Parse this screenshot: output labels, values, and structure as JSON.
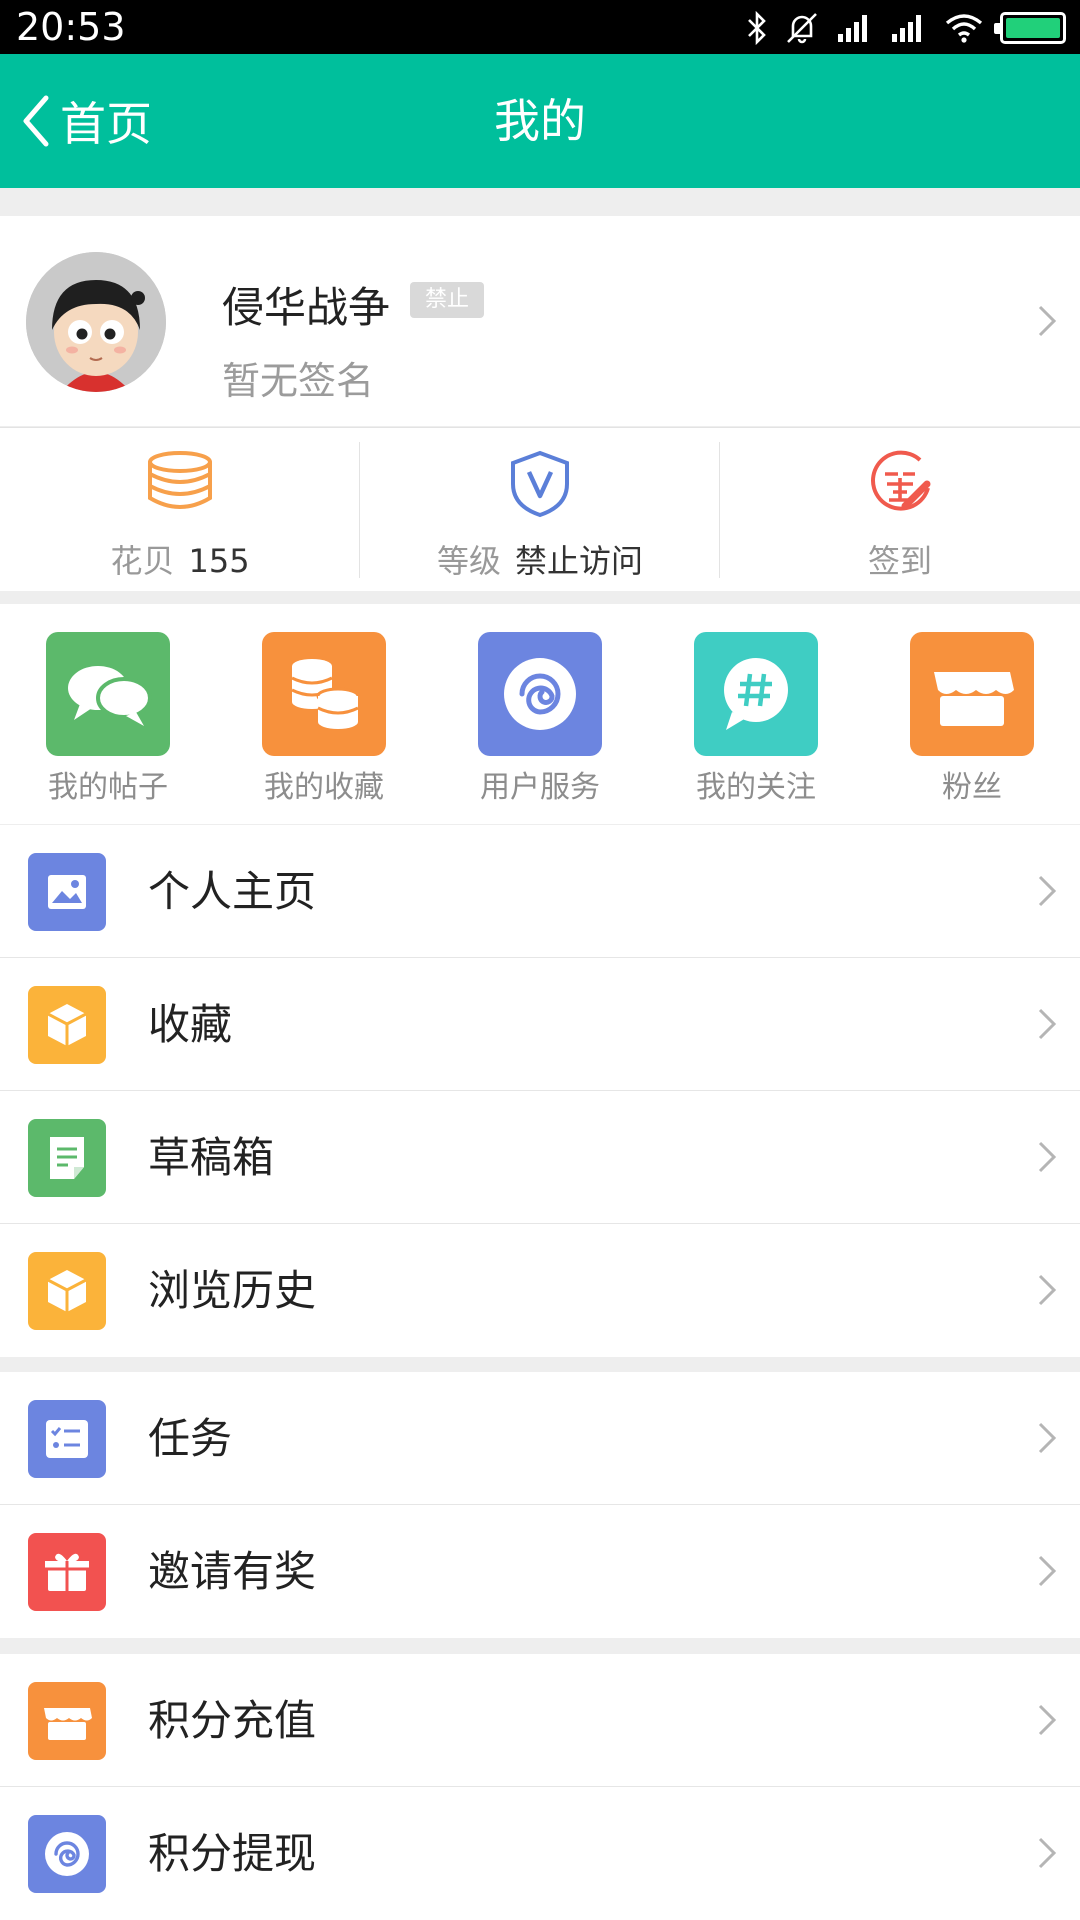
{
  "status_bar": {
    "time": "20:53"
  },
  "nav": {
    "back_label": "首页",
    "title": "我的"
  },
  "profile": {
    "username": "侵华战争",
    "badge": "禁止",
    "signature": "暂无签名"
  },
  "stats": [
    {
      "label": "花贝",
      "value": "155",
      "icon": "coins-stack-icon"
    },
    {
      "label": "等级",
      "value": "禁止访问",
      "icon": "shield-v-icon"
    },
    {
      "label": "签到",
      "value": "",
      "icon": "sign-in-icon"
    }
  ],
  "grid": [
    {
      "label": "我的帖子",
      "icon": "chat-bubbles-icon",
      "color": "#5cb96b"
    },
    {
      "label": "我的收藏",
      "icon": "coins-icon",
      "color": "#f7913d"
    },
    {
      "label": "用户服务",
      "icon": "swirl-icon",
      "color": "#6c85e0"
    },
    {
      "label": "我的关注",
      "icon": "hashtag-bubble-icon",
      "color": "#3fcdc3"
    },
    {
      "label": "粉丝",
      "icon": "shop-icon",
      "color": "#f7913d"
    }
  ],
  "menu_group_1": [
    {
      "label": "个人主页",
      "icon": "picture-icon",
      "color": "#6c85e0"
    },
    {
      "label": "收藏",
      "icon": "box-icon",
      "color": "#fbb33a"
    },
    {
      "label": "草稿箱",
      "icon": "draft-note-icon",
      "color": "#5cb96b"
    },
    {
      "label": "浏览历史",
      "icon": "box-icon",
      "color": "#fbb33a"
    }
  ],
  "menu_group_2": [
    {
      "label": "任务",
      "icon": "task-list-icon",
      "color": "#6c85e0"
    },
    {
      "label": "邀请有奖",
      "icon": "gift-icon",
      "color": "#f25250"
    }
  ],
  "menu_group_3": [
    {
      "label": "积分充值",
      "icon": "shop-icon",
      "color": "#f7913d"
    },
    {
      "label": "积分提现",
      "icon": "swirl-icon",
      "color": "#6c85e0"
    }
  ]
}
